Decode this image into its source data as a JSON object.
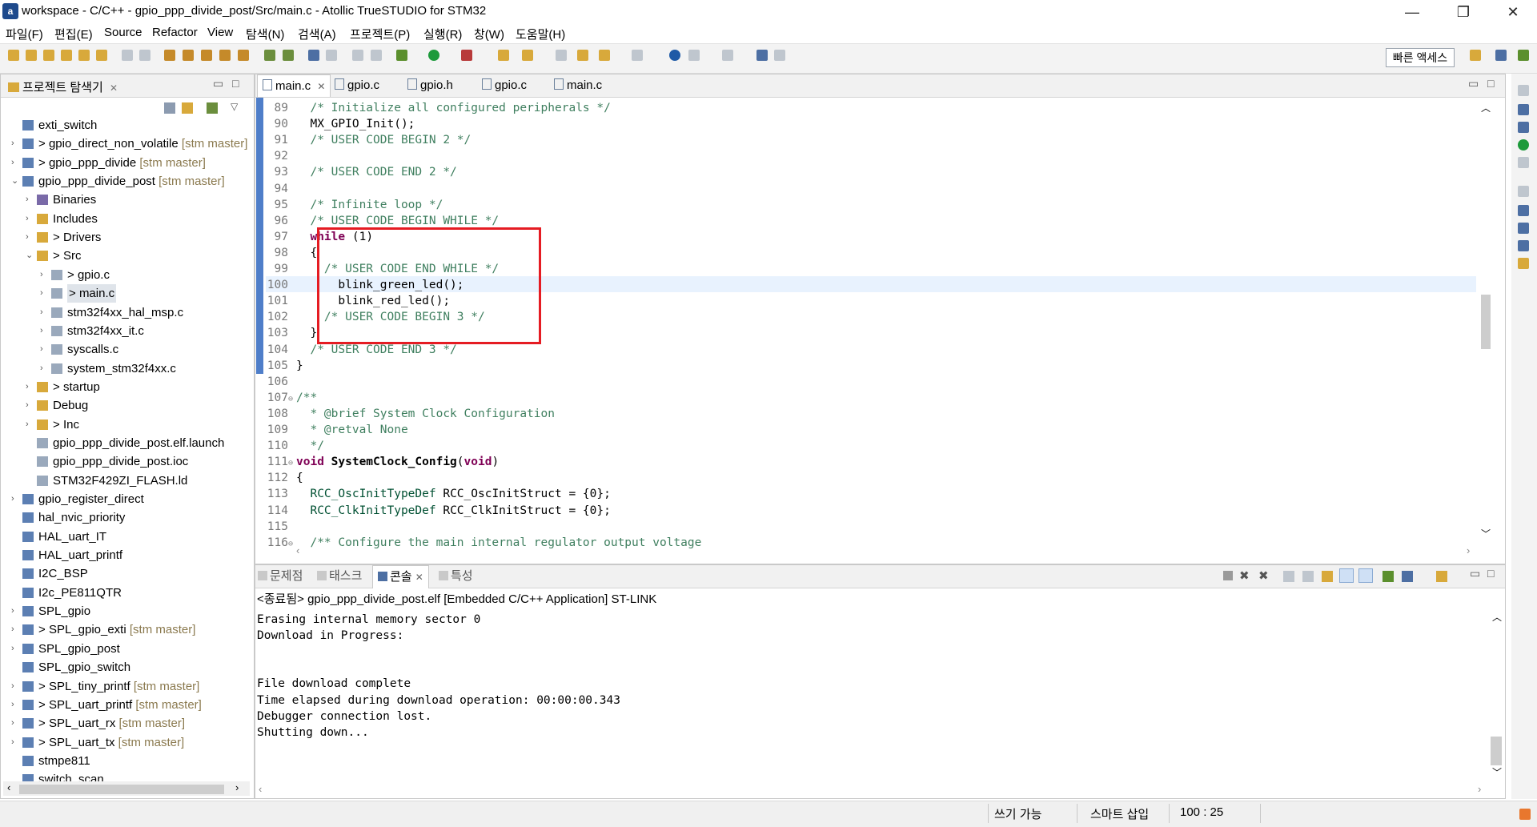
{
  "window": {
    "title": "workspace - C/C++ - gpio_ppp_divide_post/Src/main.c - Atollic TrueSTUDIO for STM32",
    "icon_letter": "a",
    "controls": {
      "minimize": "—",
      "restore": "❐",
      "close": "✕"
    }
  },
  "menu": [
    "파일(F)",
    "편집(E)",
    "Source",
    "Refactor",
    "View",
    "탐색(N)",
    "검색(A)",
    "프로젝트(P)",
    "실행(R)",
    "창(W)",
    "도움말(H)"
  ],
  "toolbar": {
    "quick_access": "빠른 액세스"
  },
  "explorer": {
    "title": "프로젝트 탐색기",
    "close": "✕",
    "items": [
      {
        "label": "exti_switch"
      },
      {
        "prefix": ">",
        "label": "gpio_direct_non_volatile",
        "repo": "[stm master]"
      },
      {
        "prefix": ">",
        "label": "gpio_ppp_divide",
        "repo": "[stm master]"
      },
      {
        "label": "gpio_ppp_divide_post",
        "repo": "[stm master]"
      },
      {
        "label": "Binaries"
      },
      {
        "label": "Includes"
      },
      {
        "prefix": ">",
        "label": "Drivers"
      },
      {
        "prefix": ">",
        "label": "Src"
      },
      {
        "prefix": ">",
        "label": "gpio.c"
      },
      {
        "prefix": ">",
        "label": "main.c"
      },
      {
        "label": "stm32f4xx_hal_msp.c"
      },
      {
        "label": "stm32f4xx_it.c"
      },
      {
        "label": "syscalls.c"
      },
      {
        "label": "system_stm32f4xx.c"
      },
      {
        "prefix": ">",
        "label": "startup"
      },
      {
        "label": "Debug"
      },
      {
        "prefix": ">",
        "label": "Inc"
      },
      {
        "label": "gpio_ppp_divide_post.elf.launch"
      },
      {
        "label": "gpio_ppp_divide_post.ioc"
      },
      {
        "label": "STM32F429ZI_FLASH.ld"
      },
      {
        "label": "gpio_register_direct"
      },
      {
        "label": "hal_nvic_priority"
      },
      {
        "label": "HAL_uart_IT"
      },
      {
        "label": "HAL_uart_printf"
      },
      {
        "label": "I2C_BSP"
      },
      {
        "label": "I2c_PE811QTR"
      },
      {
        "label": "SPL_gpio"
      },
      {
        "prefix": ">",
        "label": "SPL_gpio_exti",
        "repo": "[stm master]"
      },
      {
        "label": "SPL_gpio_post"
      },
      {
        "label": "SPL_gpio_switch"
      },
      {
        "prefix": ">",
        "label": "SPL_tiny_printf",
        "repo": "[stm master]"
      },
      {
        "prefix": ">",
        "label": "SPL_uart_printf",
        "repo": "[stm master]"
      },
      {
        "prefix": ">",
        "label": "SPL_uart_rx",
        "repo": "[stm master]"
      },
      {
        "prefix": ">",
        "label": "SPL_uart_tx",
        "repo": "[stm master]"
      },
      {
        "label": "stmpe811"
      },
      {
        "label": "switch_scan"
      }
    ]
  },
  "editor": {
    "tabs": [
      {
        "label": "main.c",
        "close": "✕"
      },
      {
        "label": "gpio.c"
      },
      {
        "label": "gpio.h"
      },
      {
        "label": "gpio.c"
      },
      {
        "label": "main.c"
      }
    ],
    "lines": [
      {
        "n": "89",
        "text": "  /* Initialize all configured peripherals */"
      },
      {
        "n": "90",
        "text": "  MX_GPIO_Init();"
      },
      {
        "n": "91",
        "text": "  /* USER CODE BEGIN 2 */"
      },
      {
        "n": "92",
        "text": ""
      },
      {
        "n": "93",
        "text": "  /* USER CODE END 2 */"
      },
      {
        "n": "94",
        "text": ""
      },
      {
        "n": "95",
        "text": "  /* Infinite loop */"
      },
      {
        "n": "96",
        "text": "  /* USER CODE BEGIN WHILE */"
      },
      {
        "n": "97",
        "text": "  while (1)"
      },
      {
        "n": "98",
        "text": "  {"
      },
      {
        "n": "99",
        "text": "    /* USER CODE END WHILE */"
      },
      {
        "n": "100",
        "text": "      blink_green_led();"
      },
      {
        "n": "101",
        "text": "      blink_red_led();"
      },
      {
        "n": "102",
        "text": "    /* USER CODE BEGIN 3 */"
      },
      {
        "n": "103",
        "text": "  }"
      },
      {
        "n": "104",
        "text": "  /* USER CODE END 3 */"
      },
      {
        "n": "105",
        "text": "}"
      },
      {
        "n": "106",
        "text": ""
      },
      {
        "n": "107",
        "text": "/**"
      },
      {
        "n": "108",
        "text": "  * @brief System Clock Configuration"
      },
      {
        "n": "109",
        "text": "  * @retval None"
      },
      {
        "n": "110",
        "text": "  */"
      },
      {
        "n": "111",
        "text": "void SystemClock_Config(void)"
      },
      {
        "n": "112",
        "text": "{"
      },
      {
        "n": "113",
        "text": "  RCC_OscInitTypeDef RCC_OscInitStruct = {0};"
      },
      {
        "n": "114",
        "text": "  RCC_ClkInitTypeDef RCC_ClkInitStruct = {0};"
      },
      {
        "n": "115",
        "text": ""
      },
      {
        "n": "116",
        "text": "  /** Configure the main internal regulator output voltage"
      }
    ]
  },
  "console": {
    "tabs": [
      {
        "label": "문제점"
      },
      {
        "label": "태스크"
      },
      {
        "label": "콘솔",
        "close": "✕"
      },
      {
        "label": "특성"
      }
    ],
    "header": "<종료됨> gpio_ppp_divide_post.elf [Embedded C/C++ Application] ST-LINK",
    "lines": [
      "Erasing internal memory sector 0",
      "Download in Progress:",
      "",
      "",
      "File download complete",
      "Time elapsed during download operation: 00:00:00.343",
      "Debugger connection lost.",
      "Shutting down..."
    ]
  },
  "status": {
    "writable": "쓰기 가능",
    "insert_mode": "스마트 삽입",
    "position": "100 : 25"
  },
  "colors": {
    "highlight_box": "#e51c23",
    "comment": "#3f7f5f",
    "keyword": "#7f0055",
    "ruler": "#4f7ec9"
  }
}
